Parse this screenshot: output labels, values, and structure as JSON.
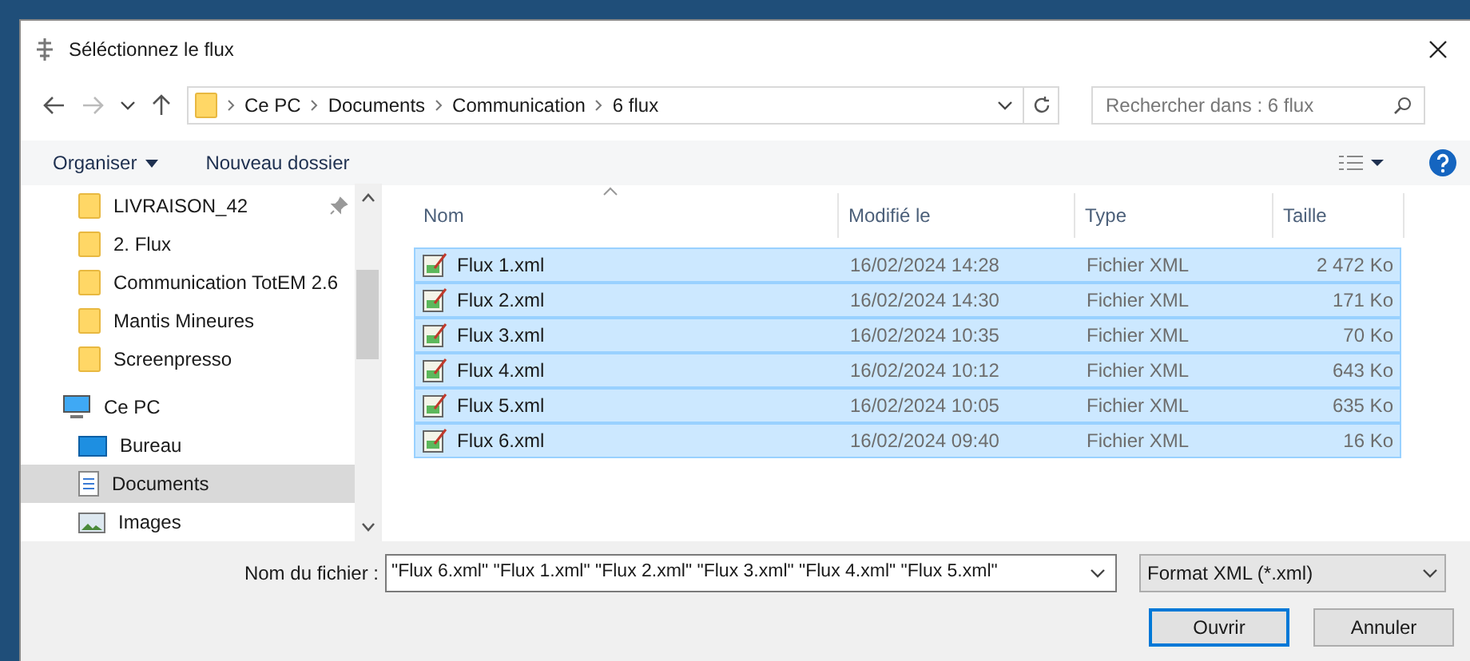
{
  "window": {
    "title": "Séléctionnez le flux"
  },
  "address_bar": {
    "crumbs": [
      "Ce PC",
      "Documents",
      "Communication",
      "6 flux"
    ]
  },
  "search": {
    "placeholder": "Rechercher dans : 6 flux"
  },
  "toolbar": {
    "organize": "Organiser",
    "new_folder": "Nouveau dossier"
  },
  "sidebar": {
    "items": [
      {
        "label": "LIVRAISON_42",
        "kind": "folder",
        "pinned": true,
        "selected": false
      },
      {
        "label": "2. Flux",
        "kind": "folder",
        "pinned": false,
        "selected": false
      },
      {
        "label": "Communication TotEM 2.6",
        "kind": "folder",
        "pinned": false,
        "selected": false
      },
      {
        "label": "Mantis Mineures",
        "kind": "folder",
        "pinned": false,
        "selected": false
      },
      {
        "label": "Screenpresso",
        "kind": "folder",
        "pinned": false,
        "selected": false
      },
      {
        "label": "Ce PC",
        "kind": "pc",
        "pinned": false,
        "selected": false
      },
      {
        "label": "Bureau",
        "kind": "desktop",
        "pinned": false,
        "selected": false
      },
      {
        "label": "Documents",
        "kind": "documents",
        "pinned": false,
        "selected": true
      },
      {
        "label": "Images",
        "kind": "images",
        "pinned": false,
        "selected": false
      }
    ]
  },
  "table": {
    "columns": [
      "Nom",
      "Modifié le",
      "Type",
      "Taille"
    ],
    "rows": [
      {
        "name": "Flux 1.xml",
        "modified": "16/02/2024 14:28",
        "type": "Fichier XML",
        "size": "2 472 Ko",
        "selected": true
      },
      {
        "name": "Flux 2.xml",
        "modified": "16/02/2024 14:30",
        "type": "Fichier XML",
        "size": "171 Ko",
        "selected": true
      },
      {
        "name": "Flux 3.xml",
        "modified": "16/02/2024 10:35",
        "type": "Fichier XML",
        "size": "70 Ko",
        "selected": true
      },
      {
        "name": "Flux 4.xml",
        "modified": "16/02/2024 10:12",
        "type": "Fichier XML",
        "size": "643 Ko",
        "selected": true
      },
      {
        "name": "Flux 5.xml",
        "modified": "16/02/2024 10:05",
        "type": "Fichier XML",
        "size": "635 Ko",
        "selected": true
      },
      {
        "name": "Flux 6.xml",
        "modified": "16/02/2024 09:40",
        "type": "Fichier XML",
        "size": "16 Ko",
        "selected": true
      }
    ]
  },
  "footer": {
    "filename_label": "Nom du fichier :",
    "filename_value": "\"Flux 6.xml\" \"Flux 1.xml\" \"Flux 2.xml\" \"Flux 3.xml\" \"Flux 4.xml\" \"Flux 5.xml\"",
    "filter": "Format XML (*.xml)",
    "open": "Ouvrir",
    "cancel": "Annuler"
  }
}
